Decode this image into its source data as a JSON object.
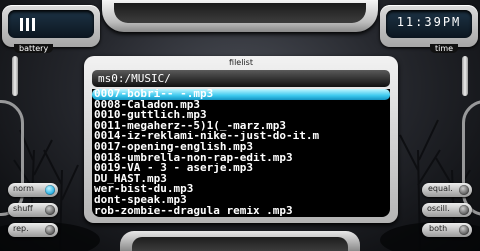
{
  "status": {
    "battery_label": "battery",
    "time_label": "time",
    "clock": "11:39PM"
  },
  "filelist": {
    "title": "filelist",
    "path": "ms0:/MUSIC/",
    "selected_index": 0,
    "files": [
      "0007-bobri-- -.mp3",
      "0008-Caladon.mp3",
      "0010-guttlich.mp3",
      "0011-megaherz--5)1(_-marz.mp3",
      "0014-iz-reklami-nike--just-do-it.m",
      "0017-opening-english.mp3",
      "0018-umbrella-non-rap-edit.mp3",
      "0019-VA - 3 - aserje.mp3",
      "DU_HAST.mp3",
      "wer-bist-du.mp3",
      "dont-speak.mp3",
      "rob-zombie--dragula remix .mp3"
    ]
  },
  "controls": {
    "left": [
      {
        "label": "norm",
        "on": true
      },
      {
        "label": "shuff",
        "on": false
      },
      {
        "label": "rep.",
        "on": false
      }
    ],
    "right": [
      {
        "label": "equal.",
        "on": false
      },
      {
        "label": "oscill.",
        "on": false
      },
      {
        "label": "both",
        "on": false
      }
    ]
  }
}
